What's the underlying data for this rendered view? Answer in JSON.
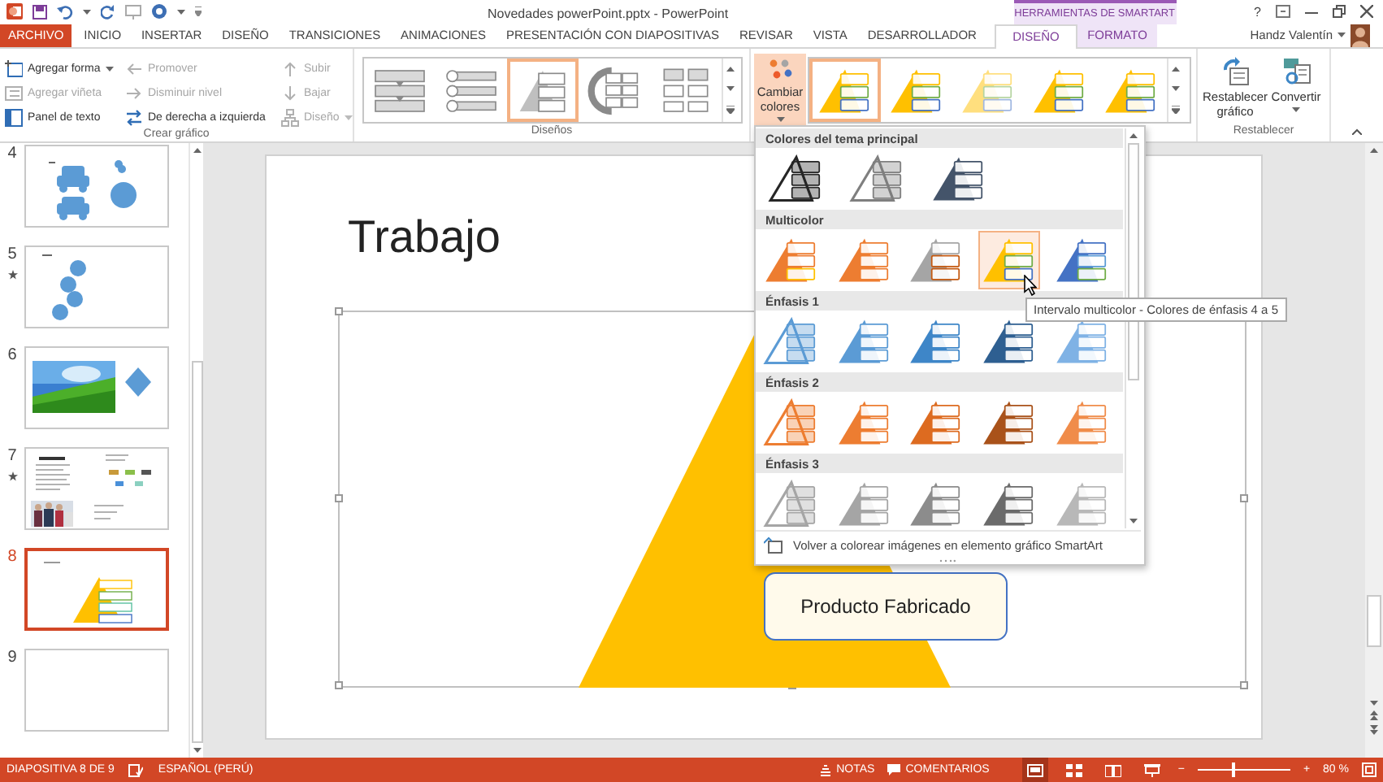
{
  "window": {
    "title": "Novedades powerPoint.pptx - PowerPoint",
    "context_group": "HERRAMIENTAS DE SMARTART",
    "help": "?"
  },
  "tabs": [
    {
      "label": "ARCHIVO",
      "kind": "file",
      "selected": false
    },
    {
      "label": "INICIO",
      "kind": "normal",
      "selected": false
    },
    {
      "label": "INSERTAR",
      "kind": "normal",
      "selected": false
    },
    {
      "label": "DISEÑO",
      "kind": "normal",
      "selected": false
    },
    {
      "label": "TRANSICIONES",
      "kind": "normal",
      "selected": false
    },
    {
      "label": "ANIMACIONES",
      "kind": "normal",
      "selected": false
    },
    {
      "label": "PRESENTACIÓN CON DIAPOSITIVAS",
      "kind": "normal",
      "selected": false
    },
    {
      "label": "REVISAR",
      "kind": "normal",
      "selected": false
    },
    {
      "label": "VISTA",
      "kind": "normal",
      "selected": false
    },
    {
      "label": "DESARROLLADOR",
      "kind": "normal",
      "selected": false
    },
    {
      "label": "DISEÑO",
      "kind": "context",
      "selected": true
    },
    {
      "label": "FORMATO",
      "kind": "context",
      "selected": false
    }
  ],
  "user": {
    "name": "Handz Valentín"
  },
  "ribbon": {
    "create_graphic": {
      "label": "Crear gráfico",
      "columns": [
        [
          {
            "label": "Agregar forma",
            "disabled": false,
            "dropdown": true
          },
          {
            "label": "Agregar viñeta",
            "disabled": true,
            "dropdown": false
          },
          {
            "label": "Panel de texto",
            "disabled": false,
            "dropdown": false
          }
        ],
        [
          {
            "label": "Promover",
            "disabled": true,
            "dropdown": false
          },
          {
            "label": "Disminuir nivel",
            "disabled": true,
            "dropdown": false
          },
          {
            "label": "De derecha a izquierda",
            "disabled": false,
            "dropdown": false
          }
        ],
        [
          {
            "label": "Subir",
            "disabled": true,
            "dropdown": false
          },
          {
            "label": "Bajar",
            "disabled": true,
            "dropdown": false
          },
          {
            "label": "Diseño",
            "disabled": true,
            "dropdown": true
          }
        ]
      ]
    },
    "layouts": {
      "label": "Diseños",
      "items": [
        {
          "kind": "process",
          "selected": false
        },
        {
          "kind": "circles",
          "selected": false
        },
        {
          "kind": "pyramid",
          "selected": true
        },
        {
          "kind": "arc",
          "selected": false
        },
        {
          "kind": "hierarchy",
          "selected": false
        }
      ]
    },
    "change_colors": {
      "label": "Cambiar colores",
      "pressed": true
    },
    "styles": {
      "items": [
        {
          "kind": "flat",
          "selected": true
        },
        {
          "kind": "flat",
          "selected": false
        },
        {
          "kind": "faded",
          "selected": false
        },
        {
          "kind": "flat",
          "selected": false
        },
        {
          "kind": "flat",
          "selected": false
        }
      ]
    },
    "reset": {
      "label": "Restablecer",
      "buttons": [
        {
          "label": "Restablecer gráfico",
          "dropdown": false
        },
        {
          "label": "Convertir",
          "dropdown": true
        }
      ]
    }
  },
  "slides": [
    {
      "number": "4",
      "kind": "shapes",
      "animated": false,
      "selected": false
    },
    {
      "number": "5",
      "kind": "circles",
      "animated": true,
      "selected": false
    },
    {
      "number": "6",
      "animated": false,
      "selected": false
    },
    {
      "number": "7",
      "kind": "text-photo",
      "animated": true,
      "selected": false
    },
    {
      "number": "8",
      "kind": "smartart",
      "animated": false,
      "selected": true
    },
    {
      "number": "9",
      "kind": "blank",
      "animated": false,
      "selected": false
    }
  ],
  "slide": {
    "title": "Trabajo",
    "smartart_box": "Producto Fabricado"
  },
  "colors_menu": {
    "sections": [
      {
        "title": "Colores del tema principal",
        "items": [
          {
            "kind": "outline",
            "color": "#262626",
            "selected": false
          },
          {
            "kind": "outline",
            "color": "#7f7f7f",
            "selected": false
          },
          {
            "kind": "solid",
            "color": "#44546a",
            "selected": false
          }
        ]
      },
      {
        "title": "Multicolor",
        "items": [
          {
            "kind": "solid",
            "color": "#ed7d31",
            "selected": false
          },
          {
            "kind": "solid",
            "color": "#ed7d31",
            "selected": false
          },
          {
            "kind": "solid",
            "color": "#a5a5a5",
            "selected": false
          },
          {
            "kind": "solid",
            "color": "#ffc000",
            "selected": true
          },
          {
            "kind": "solid",
            "color": "#4472c4",
            "selected": false
          }
        ]
      },
      {
        "title": "Énfasis 1",
        "items": [
          {
            "kind": "outline",
            "color": "#5b9bd5",
            "selected": false
          },
          {
            "kind": "solid",
            "color": "#5b9bd5",
            "selected": false
          },
          {
            "kind": "solid",
            "color": "#3e86c8",
            "selected": false
          },
          {
            "kind": "solid",
            "color": "#2e5f91",
            "selected": false
          },
          {
            "kind": "solid",
            "color": "#7fb2e5",
            "selected": false
          }
        ]
      },
      {
        "title": "Énfasis 2",
        "items": [
          {
            "kind": "outline",
            "color": "#ed7d31",
            "selected": false
          },
          {
            "kind": "solid",
            "color": "#ed7d31",
            "selected": false
          },
          {
            "kind": "solid",
            "color": "#dd6b20",
            "selected": false
          },
          {
            "kind": "solid",
            "color": "#a9521a",
            "selected": false
          },
          {
            "kind": "solid",
            "color": "#f08c4a",
            "selected": false
          }
        ]
      },
      {
        "title": "Énfasis 3",
        "items": [
          {
            "kind": "outline",
            "color": "#a5a5a5",
            "selected": false
          },
          {
            "kind": "solid",
            "color": "#a5a5a5",
            "selected": false
          },
          {
            "kind": "solid",
            "color": "#8c8c8c",
            "selected": false
          },
          {
            "kind": "solid",
            "color": "#6b6b6b",
            "selected": false
          },
          {
            "kind": "solid",
            "color": "#b8b8b8",
            "selected": false
          }
        ]
      }
    ],
    "footer": "Volver a colorear imágenes en elemento gráfico SmartArt"
  },
  "tooltip": "Intervalo multicolor - Colores de énfasis 4 a 5",
  "status_bar": {
    "slide": "DIAPOSITIVA 8 DE 9",
    "language": "ESPAÑOL (PERÚ)",
    "notes": "NOTAS",
    "comments": "COMENTARIOS",
    "views": [
      {
        "kind": "normal",
        "selected": true
      },
      {
        "kind": "sorter",
        "selected": false
      },
      {
        "kind": "reading",
        "selected": false
      },
      {
        "kind": "show",
        "selected": false
      }
    ],
    "zoom_out": "−",
    "zoom_in": "+",
    "zoom": {
      "level": 0.37
    },
    "zoom_reading": "80 %"
  }
}
